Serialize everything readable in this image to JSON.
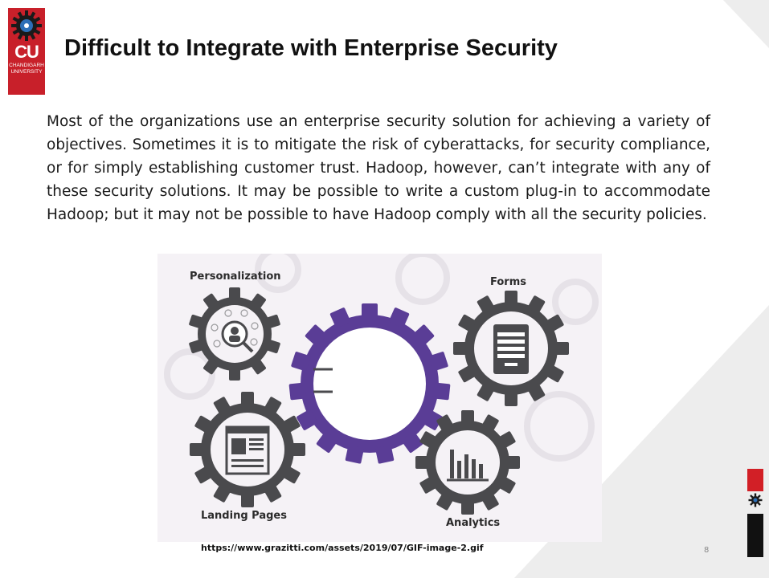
{
  "logo": {
    "short": "CU",
    "name": "CHANDIGARH UNIVERSITY"
  },
  "slide": {
    "title": "Difficult to Integrate with Enterprise Security",
    "body": "Most of the organizations use an enterprise security solution for achieving a variety of objectives. Sometimes it is to mitigate the risk of cyberattacks, for security compliance, or for simply establishing customer trust. Hadoop, however, can’t integrate with any of these security solutions. It may be possible to write a custom plug-in to accommodate Hadoop; but it may not be possible to have Hadoop comply with all the security policies.",
    "source_url": "https://www.grazitti.com/assets/2019/07/GIF-image-2.gif",
    "page_number": "8"
  },
  "figure": {
    "labels": {
      "personalization": "Personalization",
      "forms": "Forms",
      "landing_pages": "Landing Pages",
      "analytics": "Analytics"
    },
    "colors": {
      "gear": "#4a4a4d",
      "center_gear": "#5a3d96",
      "background": "#f5f2f6"
    }
  },
  "colors": {
    "brand_red": "#c8202a",
    "accent_red": "#d21f26"
  }
}
